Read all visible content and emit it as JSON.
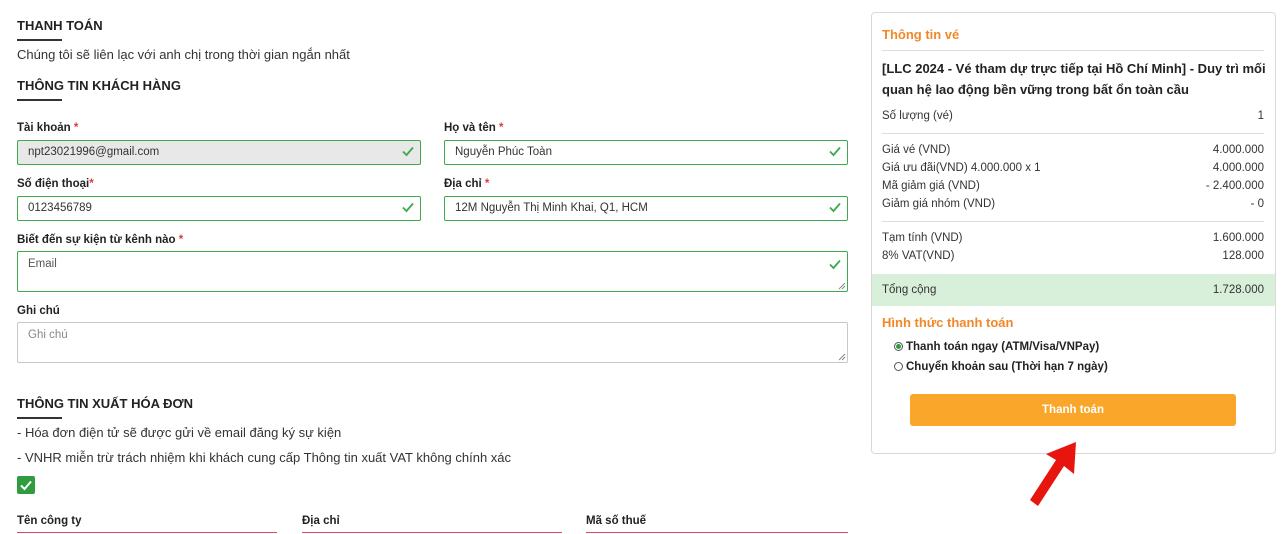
{
  "checkout": {
    "title": "THANH TOÁN",
    "subtitle": "Chúng tôi sẽ liên lạc với anh chị trong thời gian ngắn nhất"
  },
  "customer": {
    "title": "THÔNG TIN KHÁCH HÀNG",
    "account_label": "Tài khoản",
    "account_value": "npt23021996@gmail.com",
    "name_label": "Họ và tên",
    "name_value": "Nguyễn Phúc Toàn",
    "phone_label": "Số điện thoại",
    "phone_value": "0123456789",
    "address_label": "Địa chỉ",
    "address_value": "12M Nguyễn Thị Minh Khai, Q1, HCM",
    "channel_label": "Biết đến sự kiện từ kênh nào",
    "channel_value": "Email",
    "note_label": "Ghi chú",
    "note_placeholder": "Ghi chú",
    "required_mark": "*"
  },
  "invoice": {
    "title": "THÔNG TIN XUẤT HÓA ĐƠN",
    "line1": "- Hóa đơn điện tử sẽ được gửi về email đăng ký sự kiện",
    "line2": "- VNHR miễn trừ trách nhiệm khi khách cung cấp Thông tin xuất VAT không chính xác",
    "checkbox_checked": true,
    "company_label": "Tên công ty",
    "address_label": "Địa chỉ",
    "tax_label": "Mã số thuế"
  },
  "ticket": {
    "title": "Thông tin vé",
    "event_name": "[LLC 2024 - Vé tham dự trực tiếp tại Hồ Chí Minh] - Duy trì mối quan hệ lao động bền vững trong bất ổn toàn cầu",
    "qty_label": "Số lượng (vé)",
    "qty_value": "1",
    "price_label": "Giá vé (VND)",
    "price_value": "4.000.000",
    "promo_label": "Giá ưu đãi(VND) 4.000.000 x 1",
    "promo_value": "4.000.000",
    "discount_label": "Mã giảm giá (VND)",
    "discount_value": "- 2.400.000",
    "group_label": "Giảm giá nhóm (VND)",
    "group_value": "- 0",
    "subtotal_label": "Tạm tính (VND)",
    "subtotal_value": "1.600.000",
    "vat_label": "8% VAT(VND)",
    "vat_value": "128.000",
    "total_label": "Tổng cộng",
    "total_value": "1.728.000"
  },
  "payment": {
    "title": "Hình thức thanh toán",
    "option1": "Thanh toán ngay (ATM/Visa/VNPay)",
    "option2": "Chuyển khoản sau (Thời hạn 7 ngày)",
    "selected": "option1",
    "button": "Thanh toán"
  },
  "colors": {
    "accent_orange": "#f0882a",
    "button_orange": "#f9a62a",
    "valid_green": "#3daa4b",
    "total_band": "#d8efd9",
    "arrow_red": "#e8150f"
  }
}
